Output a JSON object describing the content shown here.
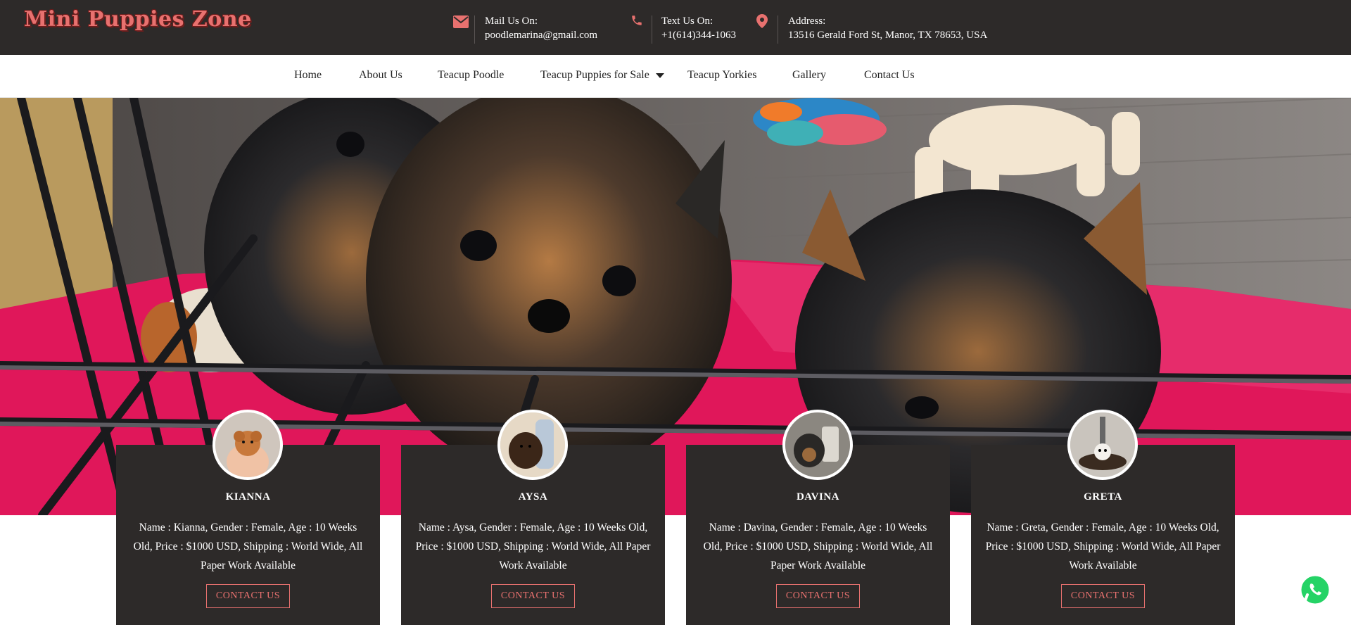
{
  "header": {
    "logo": "Mini Puppies Zone",
    "mail": {
      "icon": "envelope-icon",
      "label": "Mail Us On:",
      "value": "poodlemarina@gmail.com"
    },
    "phone": {
      "icon": "phone-icon",
      "label": "Text Us On:",
      "value": "+1(614)344-1063"
    },
    "address": {
      "icon": "map-pin-icon",
      "label": "Address:",
      "value": "13516 Gerald Ford St, Manor, TX 78653, USA"
    }
  },
  "nav": {
    "items": [
      {
        "label": "Home"
      },
      {
        "label": "About Us"
      },
      {
        "label": "Teacup Poodle"
      },
      {
        "label": "Teacup Puppies for Sale",
        "dropdown": true
      },
      {
        "label": "Teacup Yorkies"
      },
      {
        "label": "Gallery"
      },
      {
        "label": "Contact Us"
      }
    ]
  },
  "puppies": [
    {
      "name": "KIANNA",
      "description": "Name : Kianna, Gender : Female, Age : 10 Weeks Old, Price : $1000 USD, Shipping : World Wide, All Paper Work Available",
      "button": "CONTACT US"
    },
    {
      "name": "AYSA",
      "description": "Name : Aysa, Gender : Female, Age : 10 Weeks Old, Price : $1000 USD, Shipping : World Wide, All Paper Work Available",
      "button": "CONTACT US"
    },
    {
      "name": "DAVINA",
      "description": "Name : Davina, Gender : Female, Age : 10 Weeks Old, Price : $1000 USD, Shipping : World Wide, All Paper Work Available",
      "button": "CONTACT US"
    },
    {
      "name": "GRETA",
      "description": "Name : Greta, Gender : Female, Age : 10 Weeks Old, Price : $1000 USD, Shipping : World Wide, All Paper Work Available",
      "button": "CONTACT US"
    }
  ],
  "colors": {
    "dark": "#2d2a29",
    "accent": "#e8716f",
    "hero_pink": "#e0175a",
    "whatsapp": "#25d366"
  },
  "floating": {
    "icon": "whatsapp-icon"
  }
}
